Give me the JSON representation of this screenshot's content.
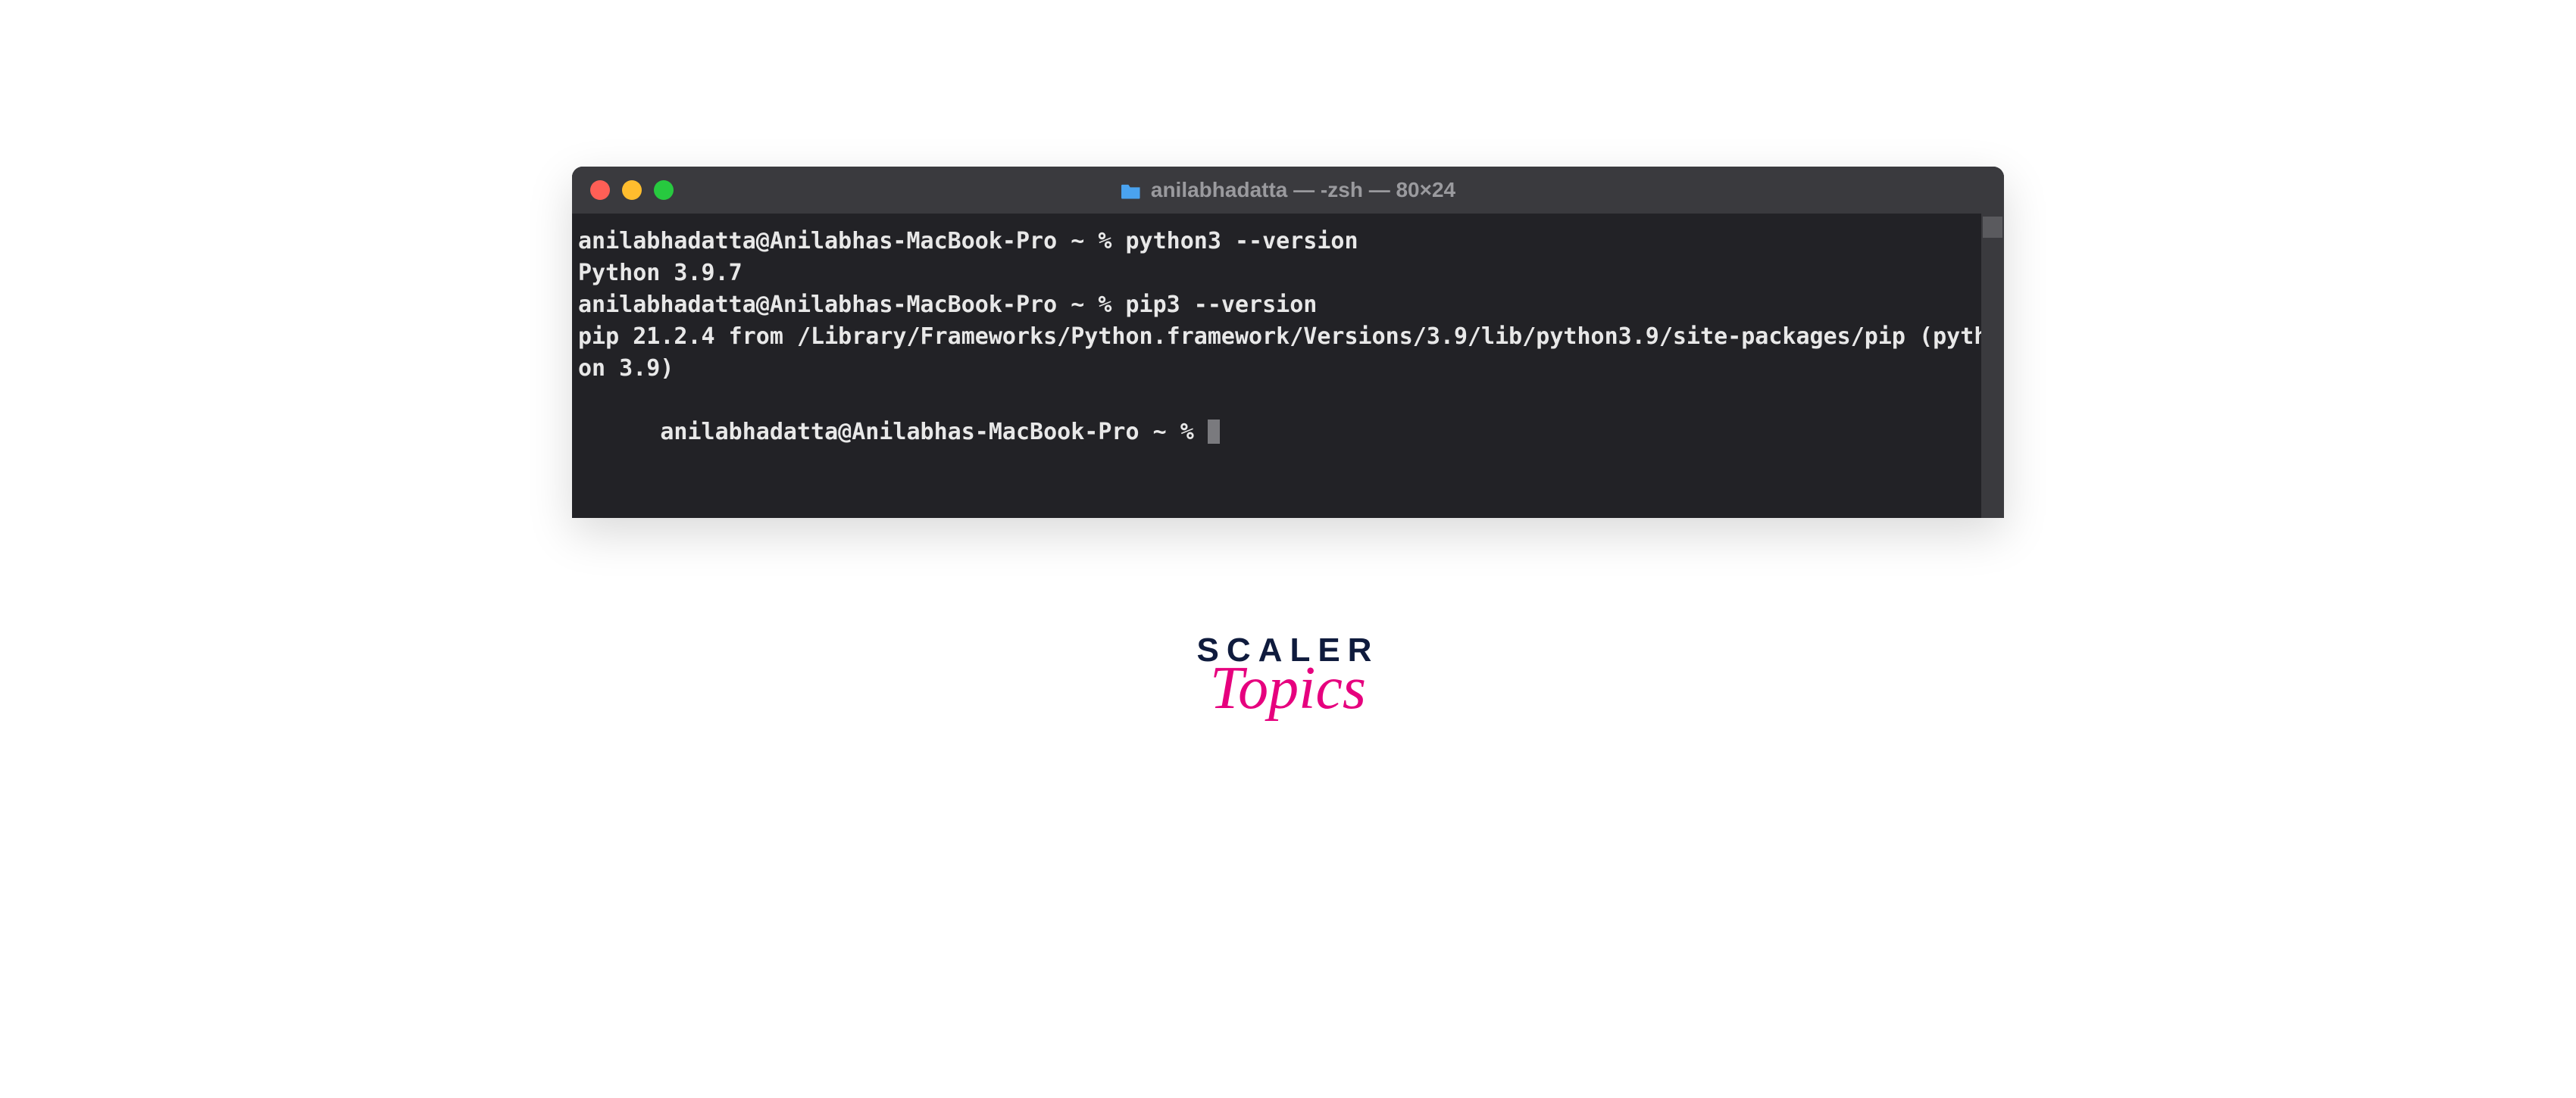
{
  "titlebar": {
    "title": "anilabhadatta — -zsh — 80×24",
    "folder_icon": "folder-icon"
  },
  "terminal": {
    "lines": [
      "anilabhadatta@Anilabhas-MacBook-Pro ~ % python3 --version",
      "Python 3.9.7",
      "anilabhadatta@Anilabhas-MacBook-Pro ~ % pip3 --version",
      "pip 21.2.4 from /Library/Frameworks/Python.framework/Versions/3.9/lib/python3.9/site-packages/pip (python 3.9)",
      "anilabhadatta@Anilabhas-MacBook-Pro ~ % "
    ]
  },
  "brand": {
    "scaler": "SCALER",
    "topics": "Topics"
  },
  "colors": {
    "terminal_bg": "#222226",
    "titlebar_bg": "#3a3a3e",
    "traffic_red": "#ff5f56",
    "traffic_yellow": "#ffbd2e",
    "traffic_green": "#27c93f",
    "brand_dark": "#0f1b3d",
    "brand_pink": "#e6007e"
  }
}
